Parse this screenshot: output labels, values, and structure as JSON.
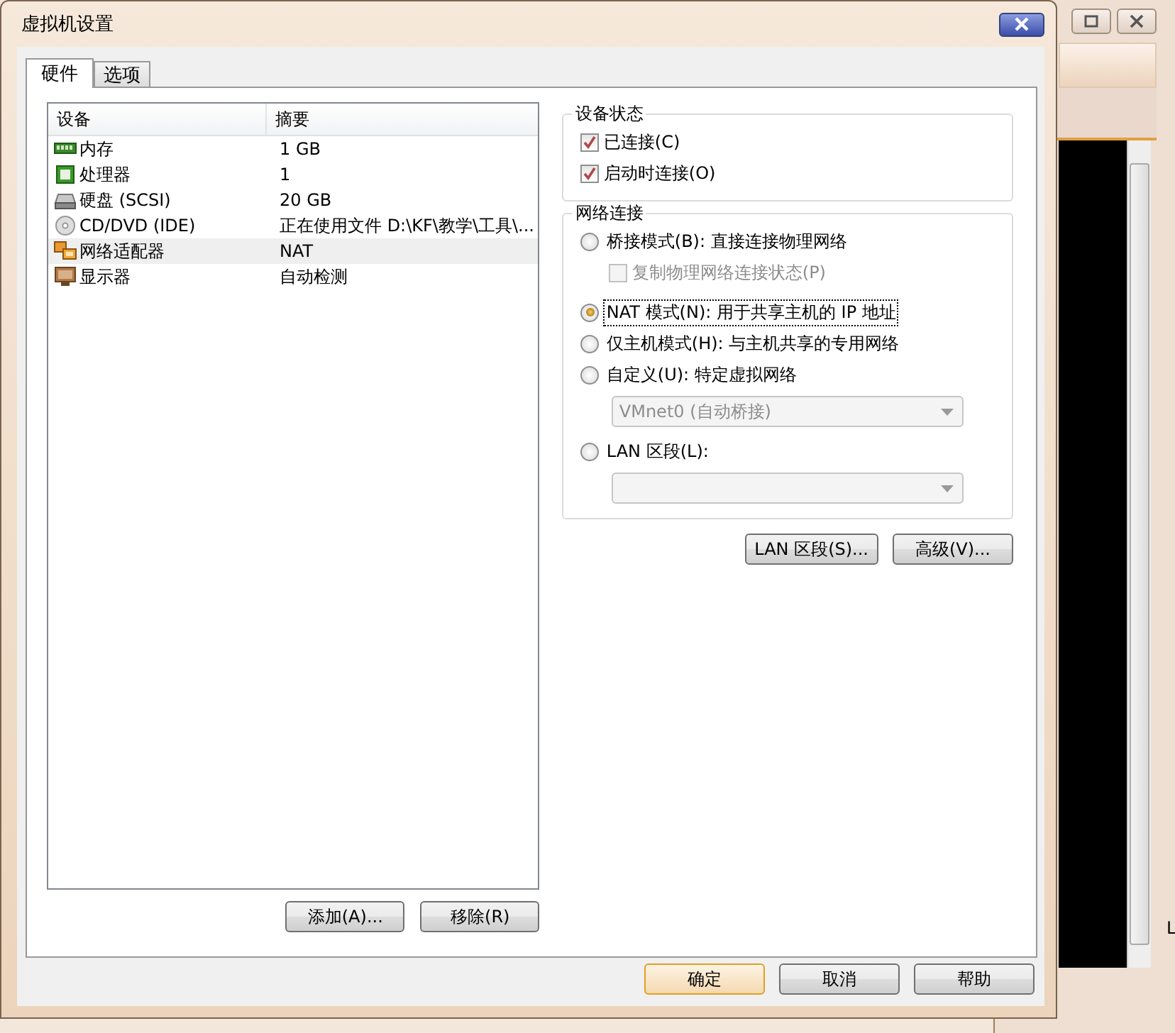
{
  "background_window": {
    "edge_text": "L"
  },
  "dialog": {
    "title": "虚拟机设置"
  },
  "tabs": [
    {
      "label": "硬件",
      "selected": true
    },
    {
      "label": "选项",
      "selected": false
    }
  ],
  "device_list": {
    "columns": [
      "设备",
      "摘要"
    ],
    "rows": [
      {
        "kind": "memory",
        "device": "内存",
        "summary": "1 GB",
        "selected": false
      },
      {
        "kind": "cpu",
        "device": "处理器",
        "summary": "1",
        "selected": false
      },
      {
        "kind": "disk",
        "device": "硬盘 (SCSI)",
        "summary": "20 GB",
        "selected": false
      },
      {
        "kind": "cd",
        "device": "CD/DVD (IDE)",
        "summary": "正在使用文件 D:\\KF\\教学\\工具\\...",
        "selected": false
      },
      {
        "kind": "network",
        "device": "网络适配器",
        "summary": "NAT",
        "selected": true
      },
      {
        "kind": "display",
        "device": "显示器",
        "summary": "自动检测",
        "selected": false
      }
    ]
  },
  "list_buttons": [
    "添加(A)...",
    "移除(R)"
  ],
  "device_status": {
    "title": "设备状态",
    "checkboxes": [
      {
        "label": "已连接(C)",
        "checked": true
      },
      {
        "label": "启动时连接(O)",
        "checked": true
      }
    ]
  },
  "network_connection": {
    "title": "网络连接",
    "items": [
      {
        "kind": "radio",
        "label": "桥接模式(B): 直接连接物理网络",
        "selected": false,
        "focused": false
      },
      {
        "kind": "checkbox",
        "label": "复制物理网络连接状态(P)",
        "checked": false,
        "disabled": true
      },
      {
        "kind": "radio",
        "label": "NAT 模式(N): 用于共享主机的 IP 地址",
        "selected": true,
        "focused": true
      },
      {
        "kind": "radio",
        "label": "仅主机模式(H): 与主机共享的专用网络",
        "selected": false,
        "focused": false
      },
      {
        "kind": "radio",
        "label": "自定义(U): 特定虚拟网络",
        "selected": false,
        "focused": false
      },
      {
        "kind": "dropdown",
        "value": "VMnet0 (自动桥接)",
        "disabled": true
      },
      {
        "kind": "radio",
        "label": "LAN 区段(L):",
        "selected": false,
        "focused": false
      },
      {
        "kind": "dropdown",
        "value": null,
        "disabled": true
      }
    ]
  },
  "network_buttons": [
    "LAN 区段(S)...",
    "高级(V)..."
  ],
  "footer_buttons": [
    {
      "label": "确定",
      "default": true
    },
    {
      "label": "取消",
      "default": false
    },
    {
      "label": "帮助",
      "default": false
    }
  ]
}
